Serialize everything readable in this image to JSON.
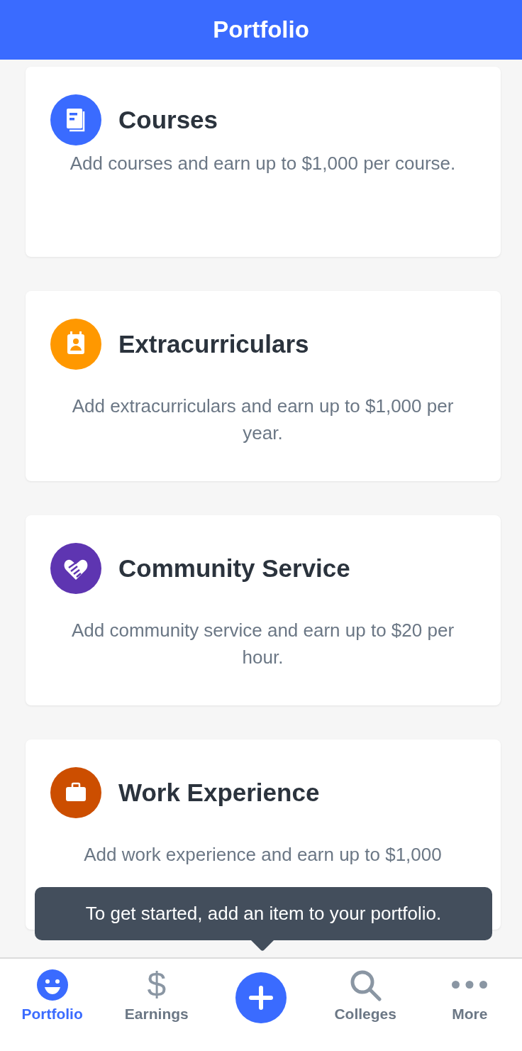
{
  "header": {
    "title": "Portfolio"
  },
  "cards": [
    {
      "kind": "courses",
      "title": "Courses",
      "description": "Add courses and earn up to $1,000 per course.",
      "color": "#3a6bff"
    },
    {
      "kind": "extracurriculars",
      "title": "Extracurriculars",
      "description": "Add extracurriculars and earn up to $1,000 per year.",
      "color": "#ff9800"
    },
    {
      "kind": "service",
      "title": "Community Service",
      "description": "Add community service and earn up to $20 per hour.",
      "color": "#5e35b1"
    },
    {
      "kind": "work",
      "title": "Work Experience",
      "description": "Add work experience and earn up to $1,000",
      "color": "#cc4e00"
    }
  ],
  "tooltip": {
    "text": "To get started, add an item to your portfolio."
  },
  "tabs": [
    {
      "kind": "smiley",
      "label": "Portfolio",
      "selected": true
    },
    {
      "kind": "glyph",
      "glyph": "$",
      "label": "Earnings",
      "selected": false
    },
    {
      "kind": "add",
      "selected": false
    },
    {
      "kind": "search",
      "label": "Colleges",
      "selected": false
    },
    {
      "kind": "dots",
      "label": "More",
      "selected": false
    }
  ]
}
